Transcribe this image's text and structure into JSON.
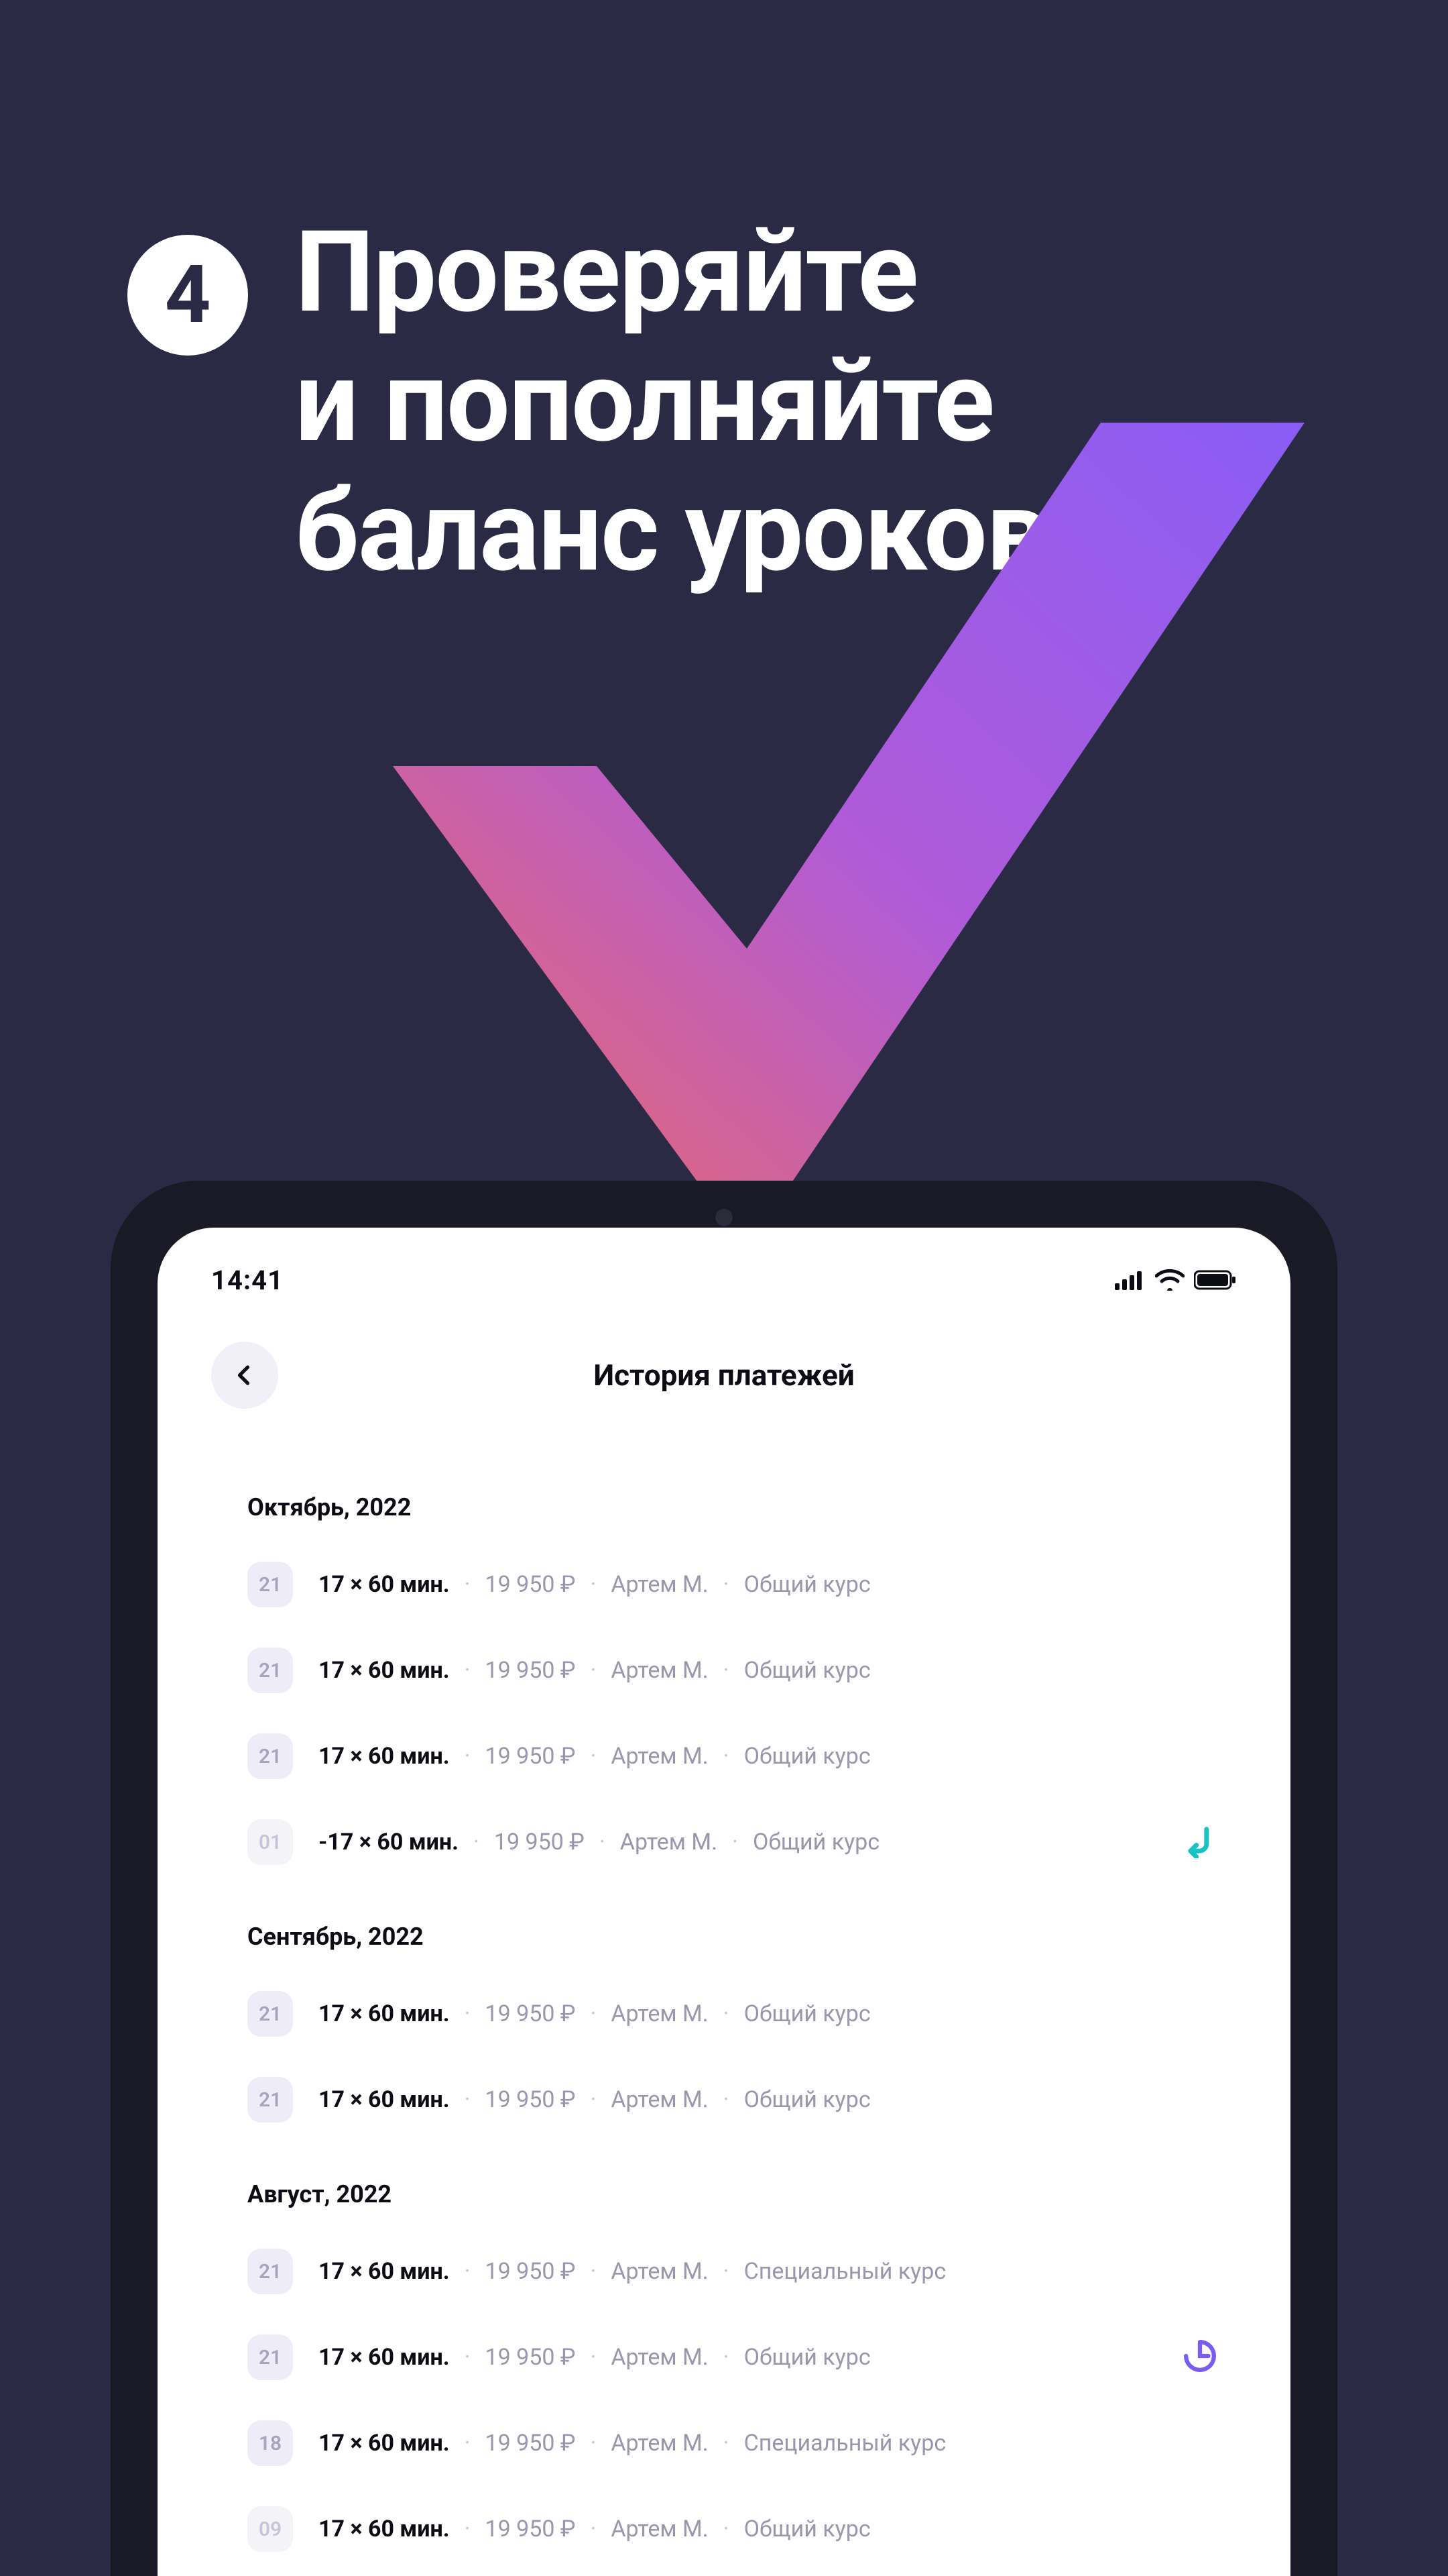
{
  "step": {
    "number": "4"
  },
  "heading": {
    "line1": "Проверяйте",
    "line2": "и пополняйте",
    "line3": "баланс уроков"
  },
  "colors": {
    "background": "#2b2a45",
    "check_grad_start": "#f26b5b",
    "check_grad_end": "#8a5cf6"
  },
  "phone": {
    "status_time": "14:41",
    "screen_title": "История платежей",
    "sections": [
      {
        "label": "Октябрь, 2022",
        "rows": [
          {
            "day": "21",
            "qty": "17 × 60 мин.",
            "price": "19 950 ₽",
            "student": "Артем М.",
            "course": "Общий курс",
            "dim": false,
            "icon": ""
          },
          {
            "day": "21",
            "qty": "17 × 60 мин.",
            "price": "19 950 ₽",
            "student": "Артем М.",
            "course": "Общий курс",
            "dim": false,
            "icon": ""
          },
          {
            "day": "21",
            "qty": "17 × 60 мин.",
            "price": "19 950 ₽",
            "student": "Артем М.",
            "course": "Общий курс",
            "dim": false,
            "icon": ""
          },
          {
            "day": "01",
            "qty": "-17 × 60 мин.",
            "price": "19 950 ₽",
            "student": "Артем М.",
            "course": "Общий курс",
            "dim": true,
            "icon": "refund"
          }
        ]
      },
      {
        "label": "Сентябрь, 2022",
        "rows": [
          {
            "day": "21",
            "qty": "17 × 60 мин.",
            "price": "19 950 ₽",
            "student": "Артем М.",
            "course": "Общий курс",
            "dim": false,
            "icon": ""
          },
          {
            "day": "21",
            "qty": "17 × 60 мин.",
            "price": "19 950 ₽",
            "student": "Артем М.",
            "course": "Общий курс",
            "dim": false,
            "icon": ""
          }
        ]
      },
      {
        "label": "Август, 2022",
        "rows": [
          {
            "day": "21",
            "qty": "17 × 60 мин.",
            "price": "19 950 ₽",
            "student": "Артем М.",
            "course": "Специальный курс",
            "dim": false,
            "icon": ""
          },
          {
            "day": "21",
            "qty": "17 × 60 мин.",
            "price": "19 950 ₽",
            "student": "Артем М.",
            "course": "Общий курс",
            "dim": false,
            "icon": "pending"
          },
          {
            "day": "18",
            "qty": "17 × 60 мин.",
            "price": "19 950 ₽",
            "student": "Артем М.",
            "course": "Специальный курс",
            "dim": false,
            "icon": ""
          },
          {
            "day": "09",
            "qty": "17 × 60 мин.",
            "price": "19 950 ₽",
            "student": "Артем М.",
            "course": "Общий курс",
            "dim": true,
            "icon": ""
          }
        ]
      }
    ]
  }
}
